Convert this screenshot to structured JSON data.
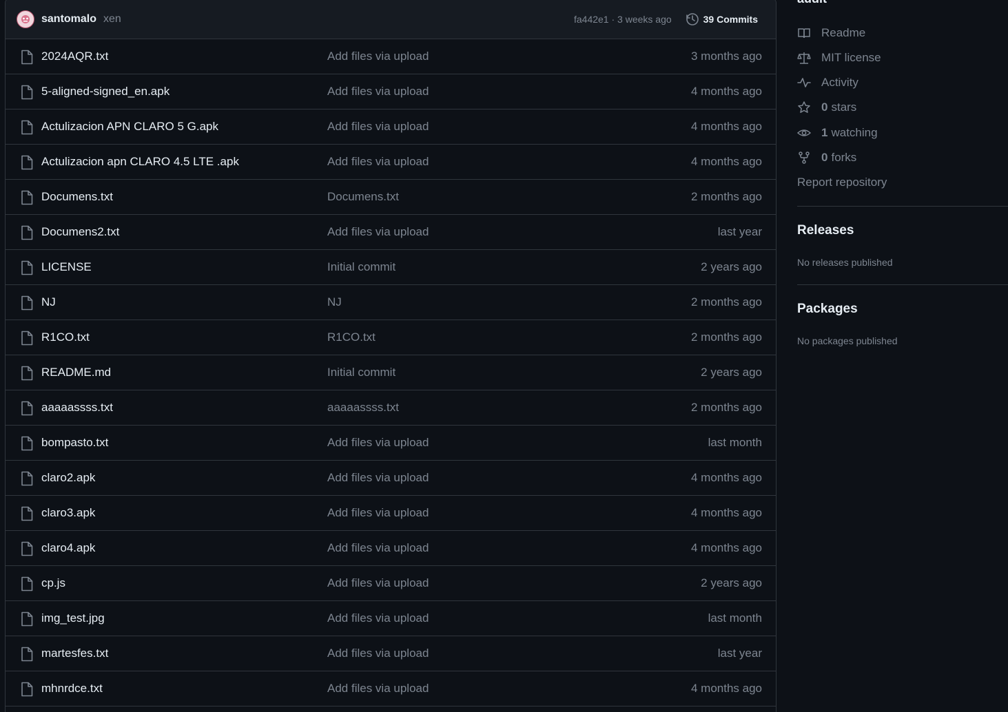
{
  "commit_bar": {
    "author": "santomalo",
    "message": "xen",
    "meta": "fa442e1 · 3 weeks ago",
    "commits_label": "39 Commits"
  },
  "files": [
    {
      "name": "2024AQR.txt",
      "message": "Add files via upload",
      "date": "3 months ago"
    },
    {
      "name": "5-aligned-signed_en.apk",
      "message": "Add files via upload",
      "date": "4 months ago"
    },
    {
      "name": "Actulizacion APN CLARO 5 G.apk",
      "message": "Add files via upload",
      "date": "4 months ago"
    },
    {
      "name": "Actulizacion apn CLARO 4.5 LTE .apk",
      "message": "Add files via upload",
      "date": "4 months ago"
    },
    {
      "name": "Documens.txt",
      "message": "Documens.txt",
      "date": "2 months ago"
    },
    {
      "name": "Documens2.txt",
      "message": "Add files via upload",
      "date": "last year"
    },
    {
      "name": "LICENSE",
      "message": "Initial commit",
      "date": "2 years ago"
    },
    {
      "name": "NJ",
      "message": "NJ",
      "date": "2 months ago"
    },
    {
      "name": "R1CO.txt",
      "message": "R1CO.txt",
      "date": "2 months ago"
    },
    {
      "name": "README.md",
      "message": "Initial commit",
      "date": "2 years ago"
    },
    {
      "name": "aaaaassss.txt",
      "message": "aaaaassss.txt",
      "date": "2 months ago"
    },
    {
      "name": "bompasto.txt",
      "message": "Add files via upload",
      "date": "last month"
    },
    {
      "name": "claro2.apk",
      "message": "Add files via upload",
      "date": "4 months ago"
    },
    {
      "name": "claro3.apk",
      "message": "Add files via upload",
      "date": "4 months ago"
    },
    {
      "name": "claro4.apk",
      "message": "Add files via upload",
      "date": "4 months ago"
    },
    {
      "name": "cp.js",
      "message": "Add files via upload",
      "date": "2 years ago"
    },
    {
      "name": "img_test.jpg",
      "message": "Add files via upload",
      "date": "last month"
    },
    {
      "name": "martesfes.txt",
      "message": "Add files via upload",
      "date": "last year"
    },
    {
      "name": "mhnrdce.txt",
      "message": "Add files via upload",
      "date": "4 months ago"
    }
  ],
  "sidebar": {
    "about_title": "audit",
    "readme": "Readme",
    "license": "MIT license",
    "activity": "Activity",
    "stars_count": "0",
    "stars_label": "stars",
    "watching_count": "1",
    "watching_label": "watching",
    "forks_count": "0",
    "forks_label": "forks",
    "report": "Report repository",
    "releases_heading": "Releases",
    "releases_note": "No releases published",
    "packages_heading": "Packages",
    "packages_note": "No packages published"
  }
}
